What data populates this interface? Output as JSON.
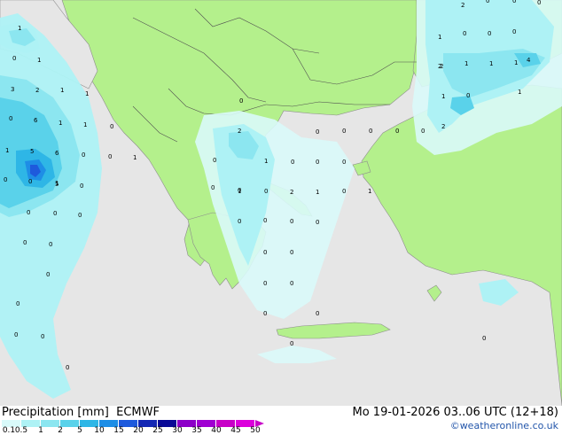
{
  "footer": {
    "title": "Precipitation [mm]  ECMWF",
    "date": "Mo 19-01-2026 03..06 UTC (12+18)",
    "credit": "©weatheronline.co.uk"
  },
  "legend": {
    "items": [
      {
        "label": "0.1",
        "color": "#d9fafa"
      },
      {
        "label": "0.5",
        "color": "#aef2f5"
      },
      {
        "label": "1",
        "color": "#8ce6f0"
      },
      {
        "label": "2",
        "color": "#5ad2ea"
      },
      {
        "label": "5",
        "color": "#2eb6e6"
      },
      {
        "label": "10",
        "color": "#1e8ee6"
      },
      {
        "label": "15",
        "color": "#1e5adc"
      },
      {
        "label": "20",
        "color": "#1428b4"
      },
      {
        "label": "25",
        "color": "#0a0a96"
      },
      {
        "label": "30",
        "color": "#8c00c8"
      },
      {
        "label": "35",
        "color": "#a000d2"
      },
      {
        "label": "40",
        "color": "#c800c8"
      },
      {
        "label": "45",
        "color": "#dc00dc"
      },
      {
        "label": "50",
        "color": "#c800c8"
      }
    ]
  },
  "map_labels": [
    "1",
    "0",
    "1",
    "3",
    "2",
    "1",
    "1",
    "0",
    "6",
    "1",
    "1",
    "0",
    "1",
    "5",
    "6",
    "0",
    "0",
    "1",
    "0",
    "0",
    "1",
    "0",
    "5",
    "0",
    "0",
    "0",
    "0",
    "0",
    "0",
    "0",
    "0",
    "0",
    "2",
    "0",
    "0",
    "0",
    "1",
    "0",
    "0",
    "0",
    "0",
    "0",
    "1",
    "0",
    "1",
    "0",
    "2",
    "1",
    "0",
    "0",
    "0",
    "0",
    "0",
    "0",
    "0",
    "0",
    "0",
    "0",
    "0",
    "0",
    "0",
    "0",
    "2",
    "0",
    "0",
    "0",
    "0",
    "1",
    "0",
    "1",
    "2",
    "1",
    "1",
    "2",
    "4",
    "1",
    "0",
    "1",
    "2",
    "0",
    "0",
    "0",
    "0"
  ],
  "colors": {
    "sea": "#e6e6e6",
    "land": "#b4f08c",
    "coast": "#8c8c8c",
    "border": "#505050"
  }
}
